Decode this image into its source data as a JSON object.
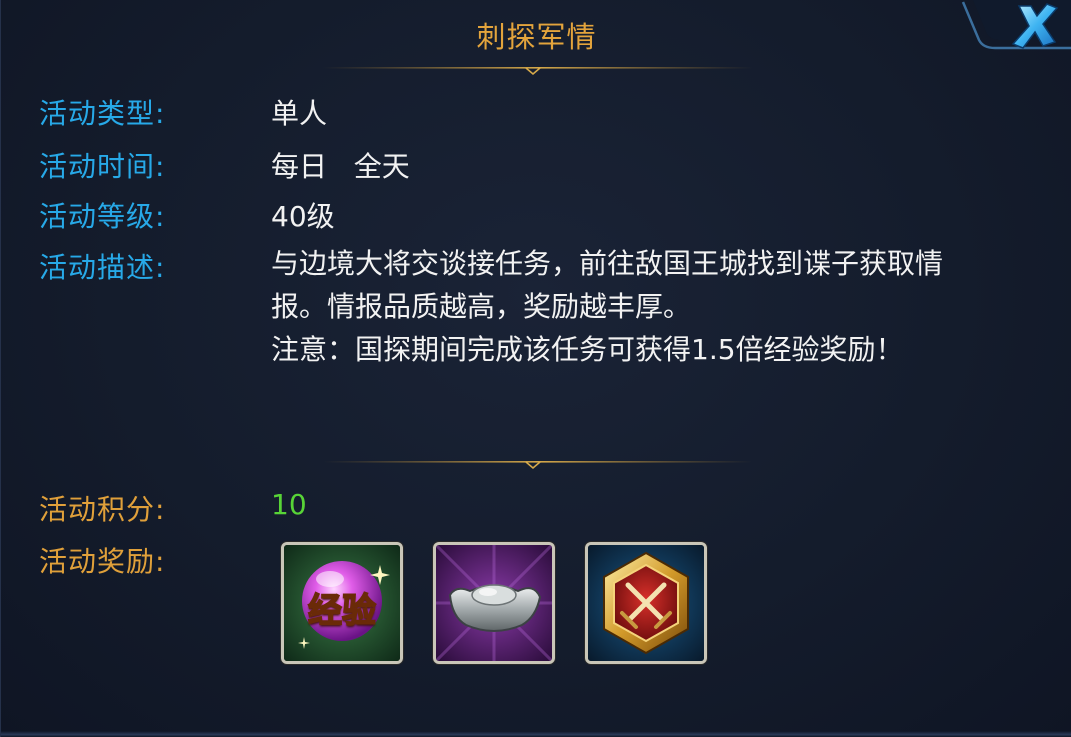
{
  "title": "刺探军情",
  "info": [
    {
      "label": "活动类型:",
      "value": "单人"
    },
    {
      "label": "活动时间:",
      "value": "每日   全天"
    },
    {
      "label": "活动等级:",
      "value": "40级"
    }
  ],
  "description": {
    "label": "活动描述:",
    "lines": [
      "与边境大将交谈接任务，前往敌国王城找到谍子获取情",
      "报。情报品质越高，奖励越丰厚。",
      "注意：国探期间完成该任务可获得1.5倍经验奖励！"
    ]
  },
  "points": {
    "label": "活动积分:",
    "value": "10"
  },
  "rewards": {
    "label": "活动奖励:",
    "items": [
      {
        "icon": "exp-orb-icon",
        "text": "经验"
      },
      {
        "icon": "silver-ingot-icon"
      },
      {
        "icon": "crossed-swords-badge-icon"
      }
    ]
  },
  "colors": {
    "title": "#e3a43c",
    "label_blue": "#27a9e8",
    "label_gold": "#e0a03a",
    "value": "#f2f2f2",
    "points": "#58d437"
  }
}
